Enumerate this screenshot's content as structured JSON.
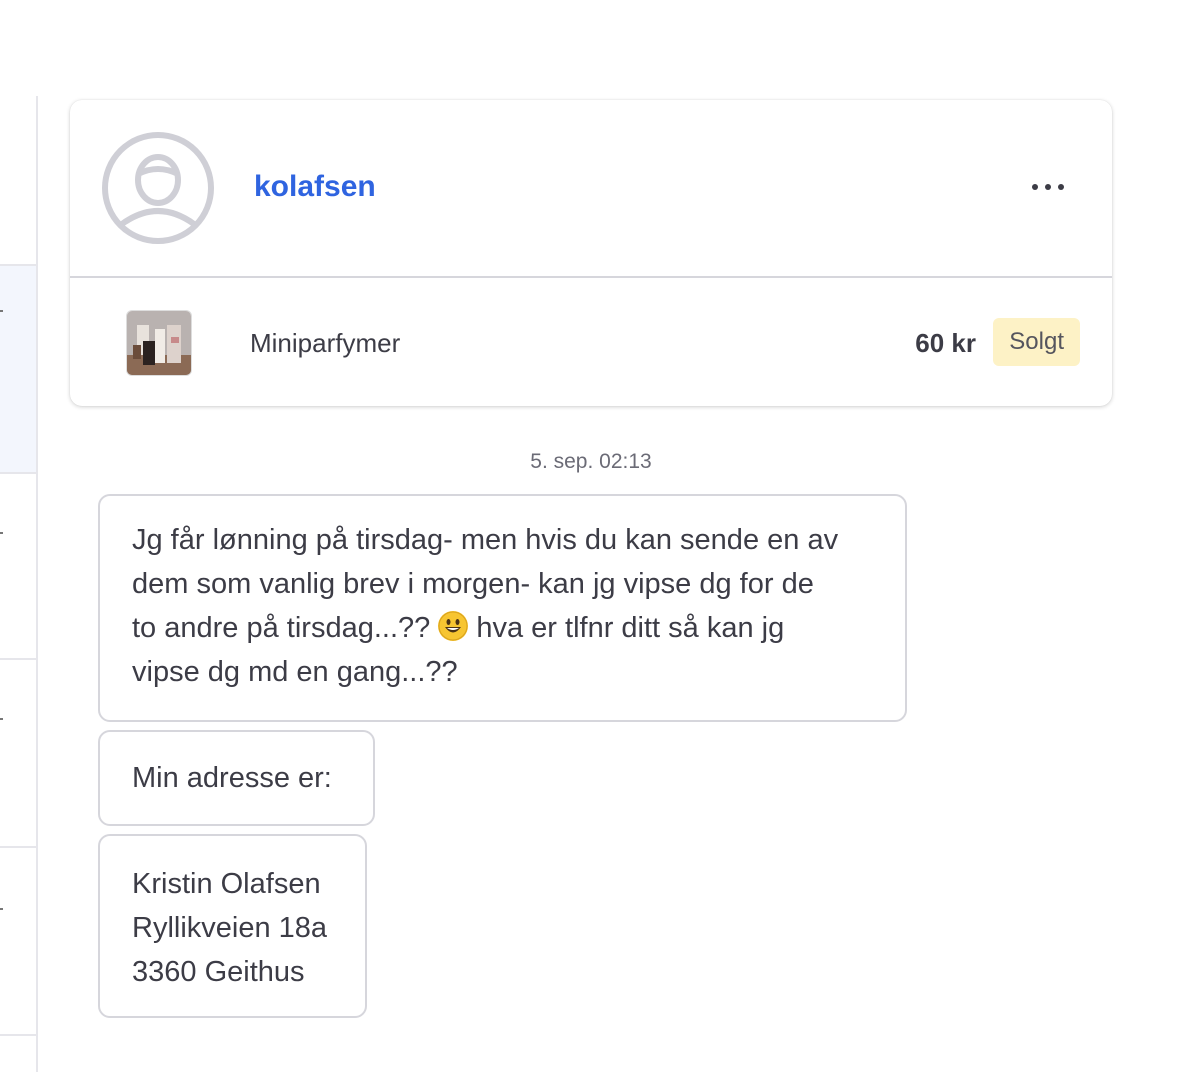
{
  "conversation": {
    "user": {
      "username": "kolafsen",
      "avatar_icon": "default-avatar-icon"
    },
    "more_menu_icon": "more-horizontal-icon",
    "item": {
      "title": "Miniparfymer",
      "price": "60 kr",
      "status": "Solgt"
    }
  },
  "messages": {
    "timestamp": "5. sep. 02:13",
    "list": [
      {
        "text_before": "Jg får lønning på tirsdag- men hvis du kan sende en av\ndem som vanlig brev i morgen- kan jg vipse dg for de\nto andre på tirsdag...?? ",
        "emoji": "smiling-face-emoji",
        "text_after": " hva er tlfnr ditt så kan jg\nvipse dg md en gang...??"
      },
      {
        "text": "Min adresse er:"
      },
      {
        "text": "Kristin Olafsen\nRyllikveien 18a\n3360 Geithus"
      }
    ]
  },
  "colors": {
    "accent": "#2f64e0",
    "badge_bg": "#fdf2c6",
    "border": "#d6d6dc"
  }
}
